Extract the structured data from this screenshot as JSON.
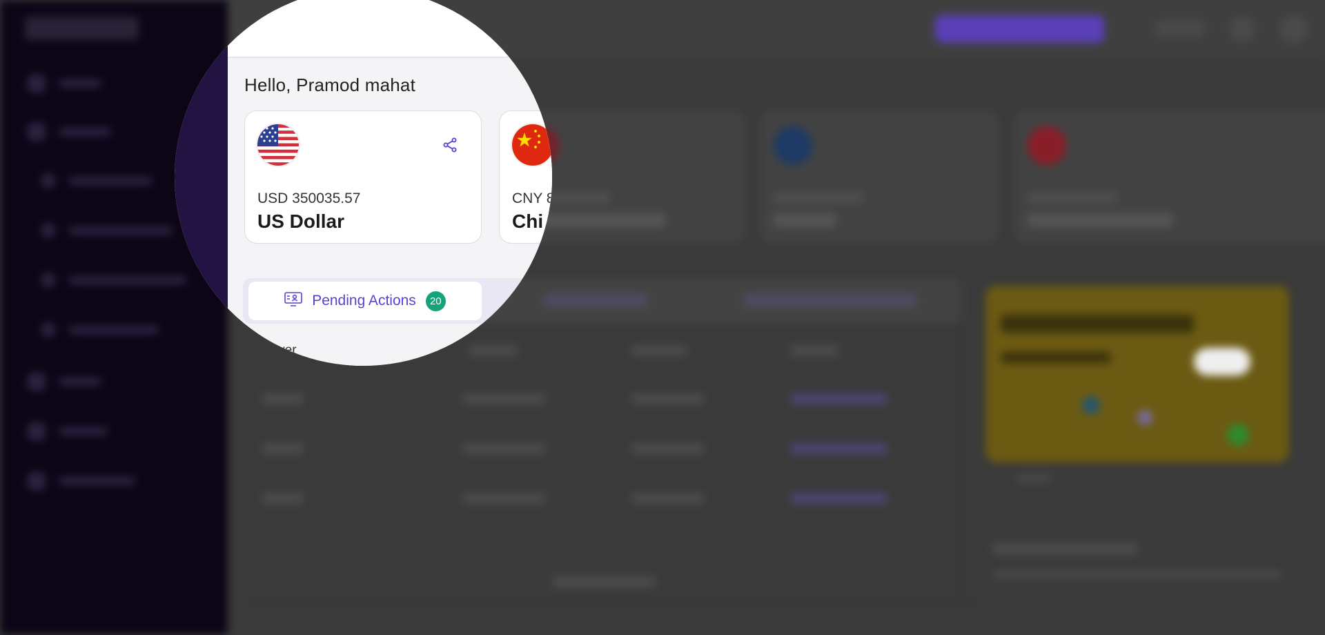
{
  "greeting": "Hello, Pramod mahat",
  "currency_cards": [
    {
      "code_amount": "USD 350035.57",
      "name": "US Dollar",
      "flag_icon": "us-flag-icon",
      "action_icon": "share-icon"
    },
    {
      "code_amount": "CNY 8",
      "name": "Chi",
      "flag_icon": "china-flag-icon"
    }
  ],
  "tabs": {
    "active": {
      "label": "Pending Actions",
      "count": "20",
      "icon": "pending-actions-icon"
    }
  },
  "table": {
    "first_column_header": "Payer"
  },
  "colors": {
    "accent": "#5b3fd1",
    "badge": "#16a37a",
    "sidebar": "#231342"
  }
}
